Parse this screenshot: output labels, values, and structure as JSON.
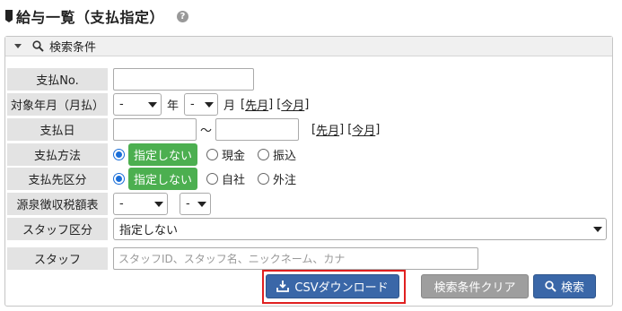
{
  "page": {
    "title": "給与一覧（支払指定）",
    "help_icon": "question-circle-icon"
  },
  "panel": {
    "header": "検索条件",
    "toggle_icon": "caret-down-icon",
    "search_icon": "magnifier-icon"
  },
  "fields": {
    "pay_no": {
      "label": "支払No.",
      "value": ""
    },
    "target_month": {
      "label": "対象年月（月払）",
      "year_value": "-",
      "year_unit": "年",
      "month_value": "-",
      "month_unit": "月",
      "prev_link": "先月",
      "curr_link": "今月"
    },
    "pay_date": {
      "label": "支払日",
      "from": "",
      "to": "",
      "sep": "〜",
      "prev_link": "先月",
      "curr_link": "今月"
    },
    "pay_method": {
      "label": "支払方法",
      "options": [
        "指定しない",
        "現金",
        "振込"
      ],
      "selected": "指定しない"
    },
    "payee_type": {
      "label": "支払先区分",
      "options": [
        "指定しない",
        "自社",
        "外注"
      ],
      "selected": "指定しない"
    },
    "withholding": {
      "label": "源泉徴収税額表",
      "value1": "-",
      "value2": "-"
    },
    "staff_type": {
      "label": "スタッフ区分",
      "value": "指定しない"
    },
    "staff": {
      "label": "スタッフ",
      "placeholder": "スタッフID、スタッフ名、ニックネーム、カナ"
    }
  },
  "buttons": {
    "csv": "CSVダウンロード",
    "clear": "検索条件クリア",
    "search": "検索"
  },
  "colors": {
    "primary": "#3a67a8",
    "selected_pill": "#4caf50",
    "highlight": "#e02020"
  }
}
